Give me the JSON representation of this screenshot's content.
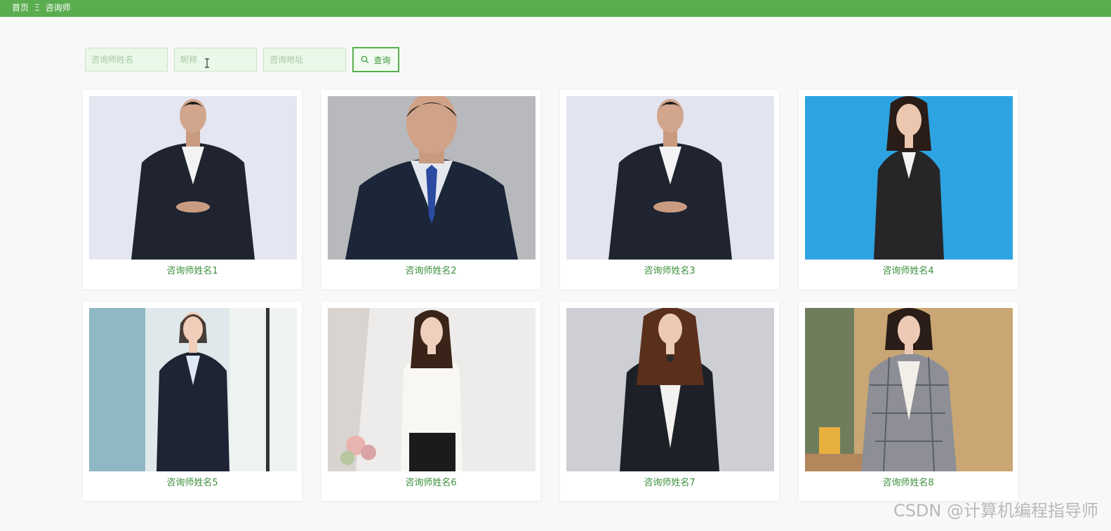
{
  "breadcrumb": {
    "home": "首页",
    "separator": "Ξ",
    "current": "咨询师"
  },
  "search": {
    "name_placeholder": "咨询师姓名",
    "nickname_placeholder": "昵称",
    "address_placeholder": "咨询地址",
    "button_label": "查询",
    "button_icon": "search-icon"
  },
  "cards": [
    {
      "name": "咨询师姓名1",
      "photo": "male-dark-suit-light-bg"
    },
    {
      "name": "咨询师姓名2",
      "photo": "male-suit-blue-tie-gray-bg"
    },
    {
      "name": "咨询师姓名3",
      "photo": "male-dark-suit-light-bg"
    },
    {
      "name": "咨询师姓名4",
      "photo": "female-dark-suit-blue-bg"
    },
    {
      "name": "咨询师姓名5",
      "photo": "female-dark-suit-window-bg"
    },
    {
      "name": "咨询师姓名6",
      "photo": "female-white-blouse-light-bg"
    },
    {
      "name": "咨询师姓名7",
      "photo": "female-dark-blazer-gray-bg"
    },
    {
      "name": "咨询师姓名8",
      "photo": "female-plaid-blazer-cafe-bg"
    }
  ],
  "watermark": "CSDN @计算机编程指导师",
  "colors": {
    "accent": "#5aad4f",
    "name_text": "#3b8f3b"
  }
}
